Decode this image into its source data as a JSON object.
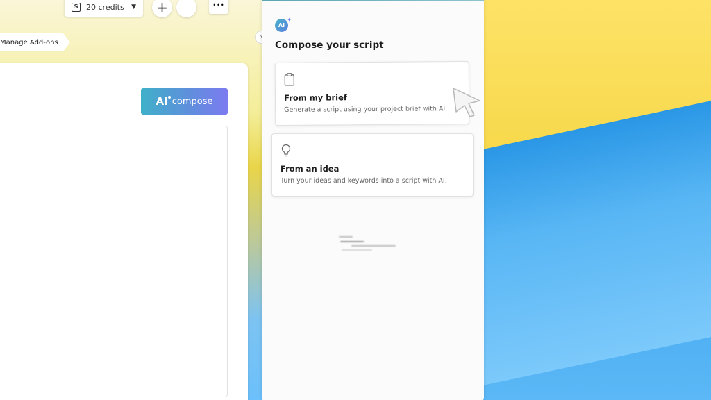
{
  "toolbar": {
    "credits_label": "20 credits",
    "credits_icon": "dollar-icon",
    "add_icon": "+",
    "more_icon": "•••"
  },
  "manage_addons_label": "Manage Add-ons",
  "editor": {
    "ai_compose": {
      "ai": "AI",
      "label": "compose"
    }
  },
  "collapse_icon": "›",
  "compose_panel": {
    "badge": "AI",
    "title": "Compose your script",
    "options": [
      {
        "icon": "clipboard-icon",
        "title": "From my brief",
        "description": "Generate a script using your project brief with AI."
      },
      {
        "icon": "lightbulb-icon",
        "title": "From an idea",
        "description": "Turn your ideas and keywords into a script with AI."
      }
    ]
  },
  "colors": {
    "accent_gradient_start": "#3fb0c9",
    "accent_gradient_end": "#7c7bf0",
    "panel_bg": "#fbfbfb"
  }
}
